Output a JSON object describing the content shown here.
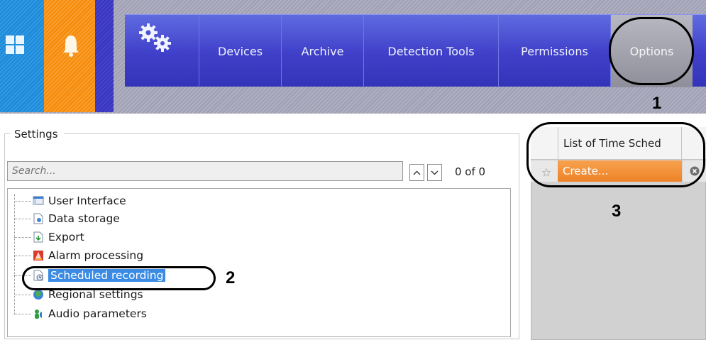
{
  "nav": {
    "items": [
      "Devices",
      "Archive",
      "Detection Tools",
      "Permissions",
      "Options"
    ]
  },
  "annotations": {
    "one": "1",
    "two": "2",
    "three": "3"
  },
  "settings": {
    "title": "Settings",
    "search_placeholder": "Search...",
    "counter": "0 of 0",
    "tree": [
      {
        "label": "User Interface",
        "icon": "user-interface-icon"
      },
      {
        "label": "Data storage",
        "icon": "data-storage-icon"
      },
      {
        "label": "Export",
        "icon": "export-icon"
      },
      {
        "label": "Alarm processing",
        "icon": "alarm-processing-icon"
      },
      {
        "label": "Scheduled recording",
        "icon": "scheduled-recording-icon",
        "selected": true
      },
      {
        "label": "Regional settings",
        "icon": "globe-icon"
      },
      {
        "label": "Audio parameters",
        "icon": "audio-parameters-icon"
      }
    ]
  },
  "schedules": {
    "header": "List of Time Sched",
    "create_label": "Create..."
  },
  "colors": {
    "windows_tile": "#1e8ad8",
    "bell_tile": "#f48c0e",
    "nav_bar": "#3f3fc9",
    "selection": "#3a8be5",
    "create_row": "#ee8227"
  }
}
